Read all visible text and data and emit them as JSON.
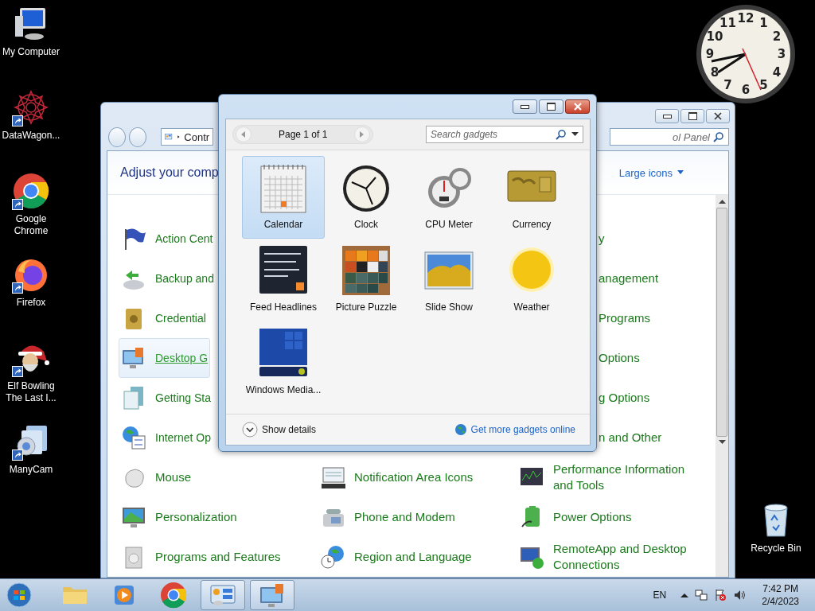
{
  "desktop_icons": [
    {
      "label": "My Computer",
      "shortcut": false
    },
    {
      "label": "DataWagon...",
      "shortcut": true
    },
    {
      "label": "Google Chrome",
      "shortcut": true
    },
    {
      "label": "Firefox",
      "shortcut": true
    },
    {
      "label": "Elf Bowling The Last I...",
      "shortcut": true
    },
    {
      "label": "ManyCam",
      "shortcut": true
    }
  ],
  "recycle_bin": {
    "label": "Recycle Bin"
  },
  "clock_gadget": {
    "numerals": [
      "11",
      "12",
      "1",
      "10",
      "2",
      "9",
      "3",
      "8",
      "4",
      "7",
      "6",
      "5"
    ]
  },
  "control_panel": {
    "address": "Contr",
    "search_placeholder": "ol Panel",
    "heading": "Adjust your comp",
    "view_by": "Large icons",
    "columns": [
      [
        {
          "kind": "full",
          "label": "Action Cent",
          "hovered": false
        },
        {
          "kind": "full",
          "label": "Backup and",
          "hovered": false
        },
        {
          "kind": "full",
          "label": "Credential",
          "hovered": false
        },
        {
          "kind": "full",
          "label": "Desktop G",
          "hovered": true
        },
        {
          "kind": "full",
          "label": "Getting Sta",
          "hovered": false
        },
        {
          "kind": "full",
          "label": "Internet Op",
          "hovered": false
        },
        {
          "kind": "full",
          "label": "Mouse",
          "hovered": false
        },
        {
          "kind": "full",
          "label": "Personalization",
          "hovered": false
        },
        {
          "kind": "full",
          "label": "Programs and Features",
          "hovered": false
        }
      ],
      [
        {
          "kind": "full",
          "label": "Notification Area Icons",
          "hovered": false
        },
        {
          "kind": "full",
          "label": "Phone and Modem",
          "hovered": false
        },
        {
          "kind": "full",
          "label": "Region and Language",
          "hovered": false
        }
      ],
      [
        {
          "kind": "cut",
          "label": "y",
          "hovered": false
        },
        {
          "kind": "cut",
          "label": "anagement",
          "hovered": false
        },
        {
          "kind": "cut",
          "label": "Programs",
          "hovered": false
        },
        {
          "kind": "cut",
          "label": "Options",
          "hovered": false
        },
        {
          "kind": "cut",
          "label": "g Options",
          "hovered": false
        },
        {
          "kind": "cut",
          "label": "n and Other",
          "hovered": false
        },
        {
          "kind": "full",
          "label": "Performance Information and Tools",
          "hovered": false
        },
        {
          "kind": "full",
          "label": "Power Options",
          "hovered": false
        },
        {
          "kind": "full",
          "label": "RemoteApp and Desktop Connections",
          "hovered": false
        }
      ]
    ]
  },
  "gadget_window": {
    "page": "Page 1 of 1",
    "search_placeholder": "Search gadgets",
    "gadgets": [
      {
        "label": "Calendar",
        "selected": true
      },
      {
        "label": "Clock",
        "selected": false
      },
      {
        "label": "CPU Meter",
        "selected": false
      },
      {
        "label": "Currency",
        "selected": false
      },
      {
        "label": "Feed Headlines",
        "selected": false
      },
      {
        "label": "Picture Puzzle",
        "selected": false
      },
      {
        "label": "Slide Show",
        "selected": false
      },
      {
        "label": "Weather",
        "selected": false
      },
      {
        "label": "Windows Media...",
        "selected": false
      }
    ],
    "details": "Show details",
    "online_link": "Get more gadgets online"
  },
  "taskbar": {
    "apps": [
      {
        "active": false
      },
      {
        "active": false
      },
      {
        "active": false
      },
      {
        "active": true
      },
      {
        "active": true
      }
    ],
    "language": "EN",
    "time": "7:42 PM",
    "date": "2/4/2023"
  }
}
